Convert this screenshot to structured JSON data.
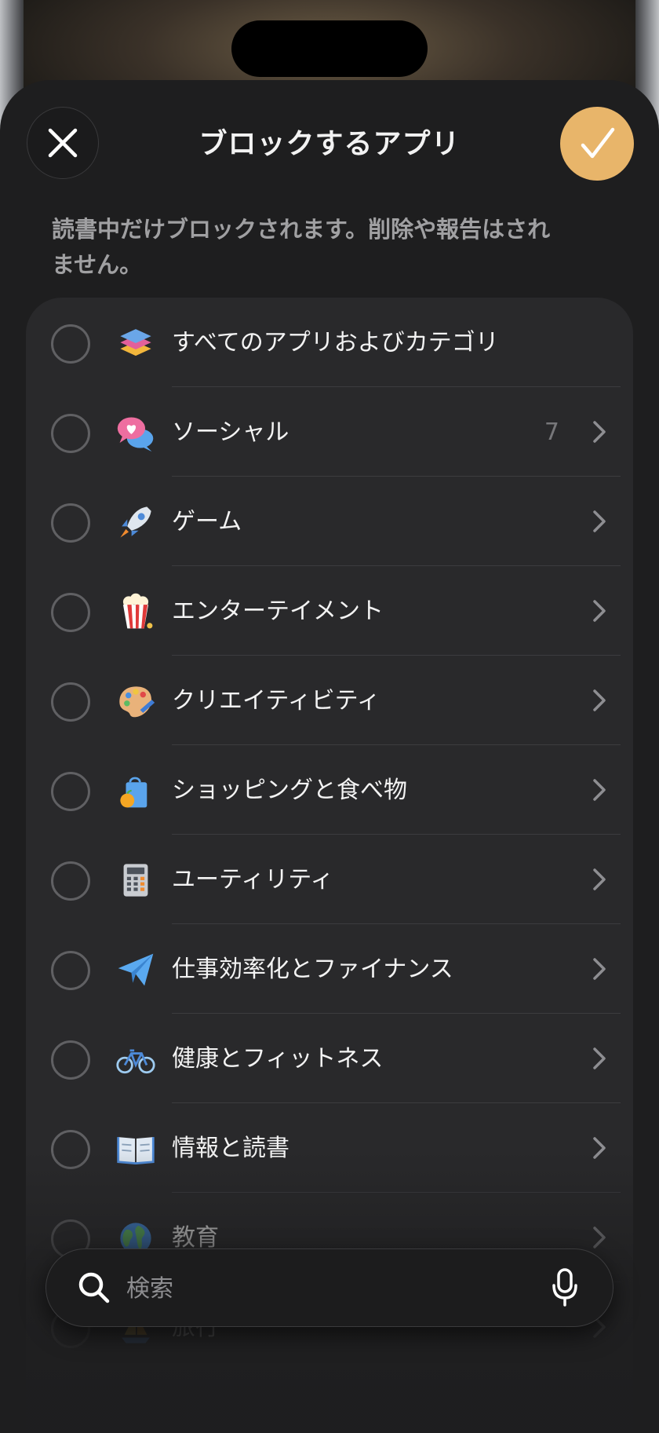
{
  "header": {
    "title": "ブロックするアプリ",
    "close_icon": "close-icon",
    "confirm_icon": "checkmark-icon",
    "accent_color": "#e8b56a"
  },
  "description": "読書中だけブロックされます。削除や報告はされません。",
  "categories": [
    {
      "label": "すべてのアプリおよびカテゴリ",
      "icon": "stacked-layers-icon",
      "count": "",
      "has_chevron": false
    },
    {
      "label": "ソーシャル",
      "icon": "chat-bubbles-heart-icon",
      "count": "7",
      "has_chevron": true
    },
    {
      "label": "ゲーム",
      "icon": "rocket-icon",
      "count": "",
      "has_chevron": true
    },
    {
      "label": "エンターテイメント",
      "icon": "popcorn-icon",
      "count": "",
      "has_chevron": true
    },
    {
      "label": "クリエイティビティ",
      "icon": "paint-palette-icon",
      "count": "",
      "has_chevron": true
    },
    {
      "label": "ショッピングと食べ物",
      "icon": "shopping-bag-icon",
      "count": "",
      "has_chevron": true
    },
    {
      "label": "ユーティリティ",
      "icon": "calculator-icon",
      "count": "",
      "has_chevron": true
    },
    {
      "label": "仕事効率化とファイナンス",
      "icon": "paper-plane-icon",
      "count": "",
      "has_chevron": true
    },
    {
      "label": "健康とフィットネス",
      "icon": "bicycle-icon",
      "count": "",
      "has_chevron": true
    },
    {
      "label": "情報と読書",
      "icon": "open-book-icon",
      "count": "",
      "has_chevron": true
    },
    {
      "label": "教育",
      "icon": "globe-icon",
      "count": "",
      "has_chevron": true
    },
    {
      "label": "旅行",
      "icon": "sailboat-icon",
      "count": "",
      "has_chevron": true
    }
  ],
  "search": {
    "placeholder": "検索",
    "search_icon": "search-icon",
    "mic_icon": "microphone-icon"
  }
}
